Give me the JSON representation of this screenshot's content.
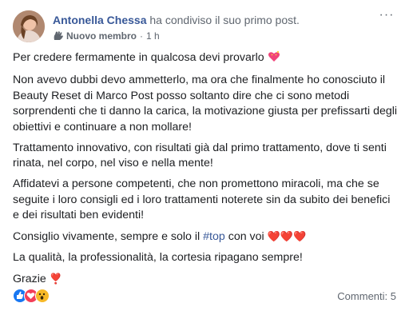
{
  "header": {
    "author": "Antonella Chessa",
    "action": "ha condiviso il suo primo post.",
    "badge": "Nuovo membro",
    "separator": "·",
    "time": "1 h",
    "more_label": "···"
  },
  "body": {
    "p1": "Per credere fermamente in qualcosa devi provarlo",
    "p2": "Non avevo dubbi devo ammetterlo, ma ora che finalmente ho conosciuto il Beauty Reset di Marco Post posso soltanto dire che ci sono metodi sorprendenti che ti danno la carica, la motivazione giusta per prefissarti degli obiettivi e continuare a non mollare!",
    "p3": "Trattamento innovativo, con risultati già dal primo trattamento, dove ti senti rinata, nel corpo, nel viso e nella mente!",
    "p4": "Affidatevi a persone competenti, che non promettono miracoli, ma che se seguite i loro consigli ed i loro trattamenti noterete sin da subito dei benefici e dei risultati ben evidenti!",
    "p5_before": "Consiglio vivamente, sempre e solo il",
    "p5_hashtag": "#top",
    "p5_after": "con voi",
    "p5_emoji": "❤️❤️❤️",
    "p6": "La qualità, la professionalità, la cortesia ripagano sempre!",
    "p7": "Grazie",
    "p7_emoji": "❣️"
  },
  "footer": {
    "reactions": [
      "like",
      "love",
      "wow"
    ],
    "comments": "Commenti: 5"
  },
  "colors": {
    "link": "#385898",
    "secondary": "#606770",
    "text": "#1c1e21"
  }
}
